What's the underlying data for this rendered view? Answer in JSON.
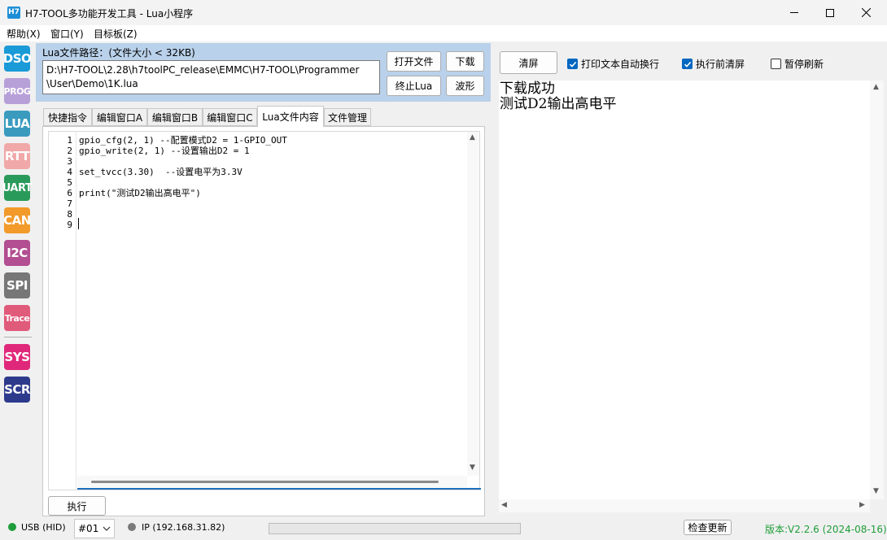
{
  "window": {
    "title": "H7-TOOL多功能开发工具 - Lua小程序",
    "app_icon": "H7"
  },
  "menu": [
    "帮助(X)",
    "窗口(Y)",
    "目标板(Z)"
  ],
  "sidebar": {
    "items": [
      {
        "label": "DSO",
        "color": "#1b9ad8"
      },
      {
        "label": "PROG",
        "color": "#b7a0d8"
      },
      {
        "label": "LUA",
        "color": "#3a9bbf"
      },
      {
        "label": "RTT",
        "color": "#f0a8a8"
      },
      {
        "label": "UART",
        "color": "#2a9a5a"
      },
      {
        "label": "CAN",
        "color": "#f29a2a"
      },
      {
        "label": "I2C",
        "color": "#b24e91"
      },
      {
        "label": "SPI",
        "color": "#777777"
      },
      {
        "label": "Trace",
        "color": "#e05a7a"
      },
      {
        "label": "SYS",
        "color": "#e0287a"
      },
      {
        "label": "SCR",
        "color": "#2d3a8c"
      }
    ]
  },
  "lua_file": {
    "path_label": "Lua文件路径：(文件大小 < 32KB)",
    "path_line1": "D:\\H7-TOOL\\2.28\\h7toolPC_release\\EMMC\\H7-TOOL\\Programmer",
    "path_line2": "\\User\\Demo\\1K.lua",
    "open_label": "打开文件",
    "download_label": "下载",
    "stop_label": "终止Lua",
    "wave_label": "波形"
  },
  "tabs": [
    {
      "label": "快捷指令"
    },
    {
      "label": "编辑窗口A"
    },
    {
      "label": "编辑窗口B"
    },
    {
      "label": "编辑窗口C"
    },
    {
      "label": "Lua文件内容"
    },
    {
      "label": "文件管理"
    }
  ],
  "editor": {
    "line_numbers": [
      "1",
      "2",
      "3",
      "4",
      "5",
      "6",
      "7",
      "8",
      "9"
    ],
    "lines": [
      "gpio_cfg(2, 1) --配置模式D2 = 1-GPIO_OUT",
      "gpio_write(2, 1) --设置输出D2 = 1",
      "",
      "set_tvcc(3.30)  --设置电平为3.3V",
      "",
      "print(\"测试D2输出高电平\")",
      "",
      "",
      ""
    ],
    "run_label": "执行"
  },
  "output": {
    "clear_label": "清屏",
    "wrap_label": "打印文本自动换行",
    "wrap_checked": true,
    "clear_before_label": "执行前清屏",
    "clear_before_checked": true,
    "pause_label": "暂停刷新",
    "pause_checked": false,
    "lines": [
      "下载成功",
      "测试D2输出高电平"
    ]
  },
  "status": {
    "usb_label": "USB (HID)",
    "usb_color": "#1e9e3a",
    "device_select": "#01",
    "ip_label": "IP (192.168.31.82)",
    "ip_color": "#7a7a7a",
    "update_label": "检查更新",
    "version_label": "版本:V2.2.6 (2024-08-16)",
    "version_color": "#1e9e3a"
  }
}
